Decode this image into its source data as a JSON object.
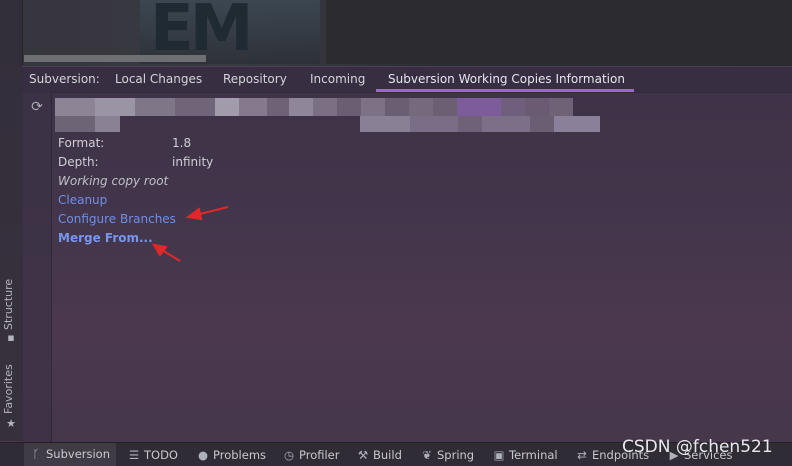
{
  "tabs": {
    "prefix": "Subversion:",
    "items": [
      {
        "label": "Local Changes",
        "active": false
      },
      {
        "label": "Repository",
        "active": false
      },
      {
        "label": "Incoming",
        "active": false
      },
      {
        "label": "Subversion Working Copies Information",
        "active": true
      }
    ],
    "accent_color": "#9a6ad4"
  },
  "left_strip": {
    "structure_label": "Structure",
    "favorites_label": "Favorites"
  },
  "info": {
    "format_label": "Format:",
    "format_value": "1.8",
    "depth_label": "Depth:",
    "depth_value": "infinity",
    "working_copy_root": "Working copy root",
    "cleanup_link": "Cleanup",
    "configure_branches_link": "Configure Branches",
    "merge_from_link": "Merge From...",
    "link_color": "#6f8fe6"
  },
  "bottom_bar": {
    "items": [
      {
        "label": "Subversion",
        "icon": "branch-icon"
      },
      {
        "label": "TODO",
        "icon": "list-icon"
      },
      {
        "label": "Problems",
        "icon": "warning-icon"
      },
      {
        "label": "Profiler",
        "icon": "profiler-icon"
      },
      {
        "label": "Build",
        "icon": "hammer-icon"
      },
      {
        "label": "Spring",
        "icon": "spring-icon"
      },
      {
        "label": "Terminal",
        "icon": "terminal-icon"
      },
      {
        "label": "Endpoints",
        "icon": "endpoints-icon"
      },
      {
        "label": "Services",
        "icon": "services-icon"
      }
    ]
  },
  "watermark": "CSDN @fchen521"
}
